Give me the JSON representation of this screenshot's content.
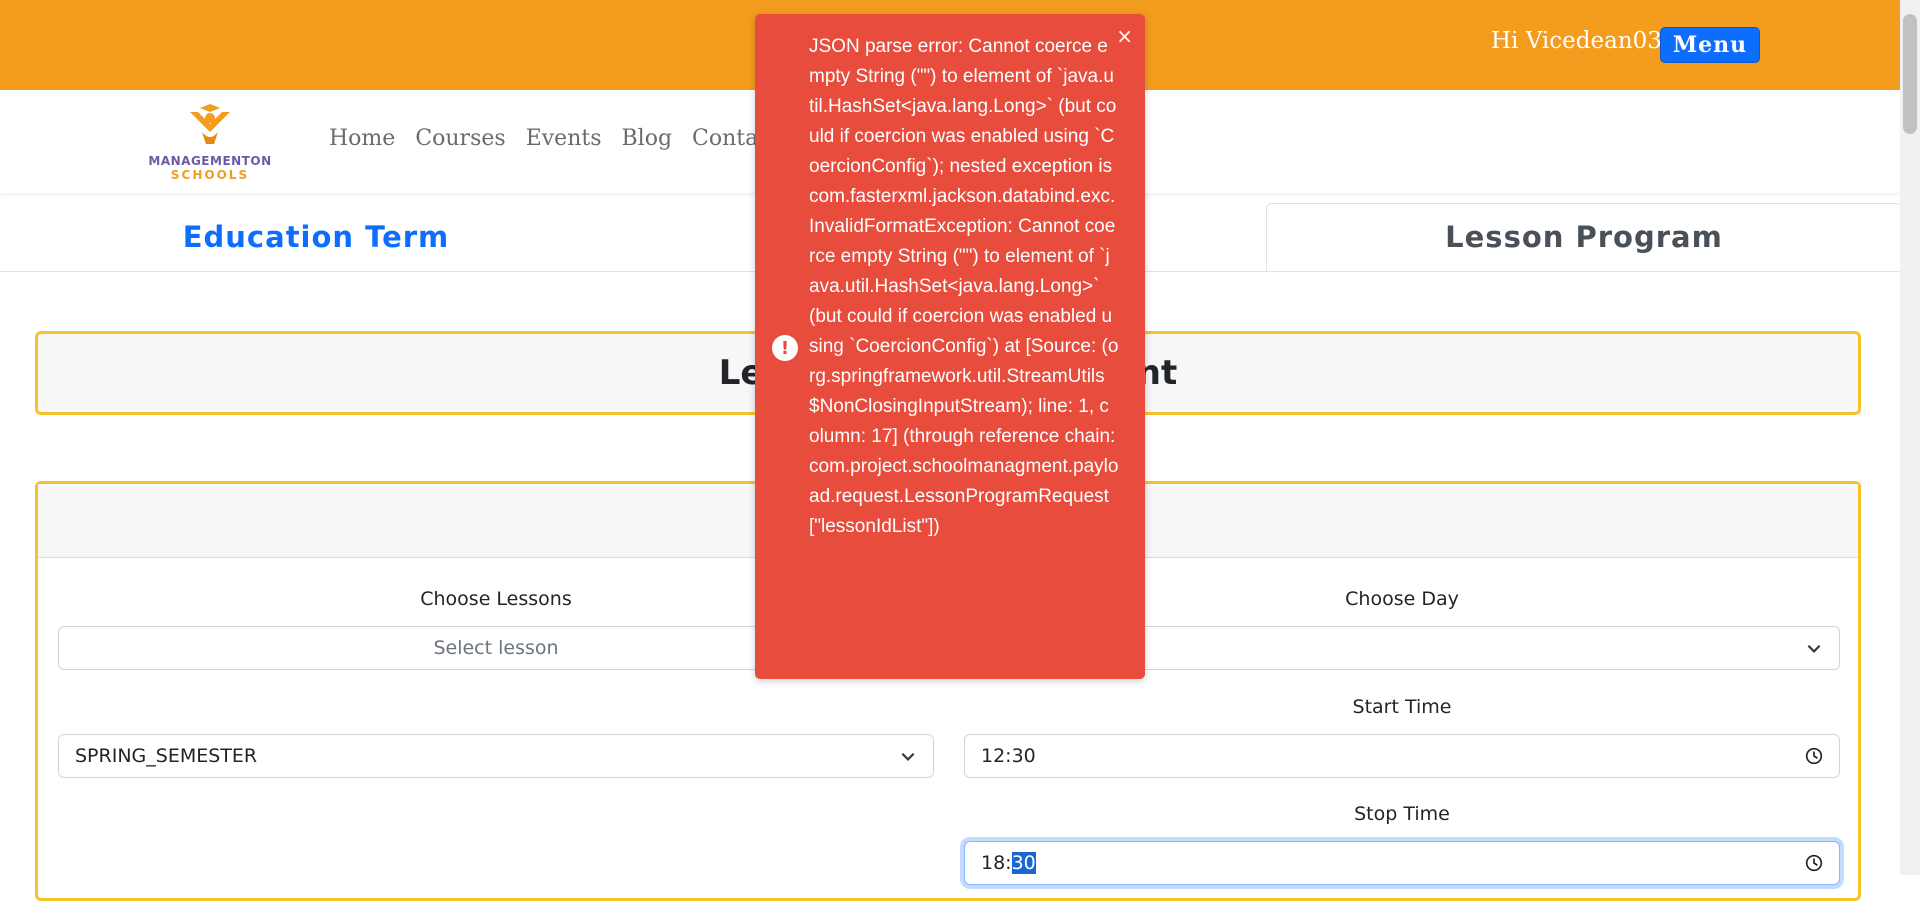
{
  "header": {
    "greeting": "Hi Vicedean03",
    "menu_label": "Menu"
  },
  "logo": {
    "line1": "MANAGEMENTON",
    "line2": "SCHOOLS"
  },
  "nav": {
    "items": [
      "Home",
      "Courses",
      "Events",
      "Blog",
      "Contact"
    ]
  },
  "tabs": {
    "education_term": "Education Term",
    "lesson_program": "Lesson Program"
  },
  "heading": {
    "visible_left": "Les",
    "visible_right": "ent"
  },
  "form": {
    "choose_lessons_label": "Choose Lessons",
    "choose_lessons_placeholder": "Select lesson",
    "choose_day_label": "Choose Day",
    "term_value": "SPRING_SEMESTER",
    "start_time_label": "Start Time",
    "start_time_value": "12:30",
    "stop_time_label": "Stop Time",
    "stop_time_hour": "18:",
    "stop_time_minute": "30"
  },
  "toast": {
    "message": "JSON parse error: Cannot coerce empty String (\"\") to element of `java.util.HashSet<java.lang.Long>` (but could if coercion was enabled using `CoercionConfig`); nested exception is com.fasterxml.jackson.databind.exc.InvalidFormatException: Cannot coerce empty String (\"\") to element of `java.util.HashSet<java.lang.Long>` (but could if coercion was enabled using `CoercionConfig`) at [Source: (org.springframework.util.StreamUtils$NonClosingInputStream); line: 1, column: 17] (through reference chain: com.project.schoolmanagment.payload.request.LessonProgramRequest[\"lessonIdList\"])",
    "close_glyph": "×",
    "icon_glyph": "!"
  },
  "colors": {
    "topbar": "#f39c1e",
    "accent": "#0d6efd",
    "toast": "#e74c3c",
    "border_highlight": "#f8c12b"
  }
}
